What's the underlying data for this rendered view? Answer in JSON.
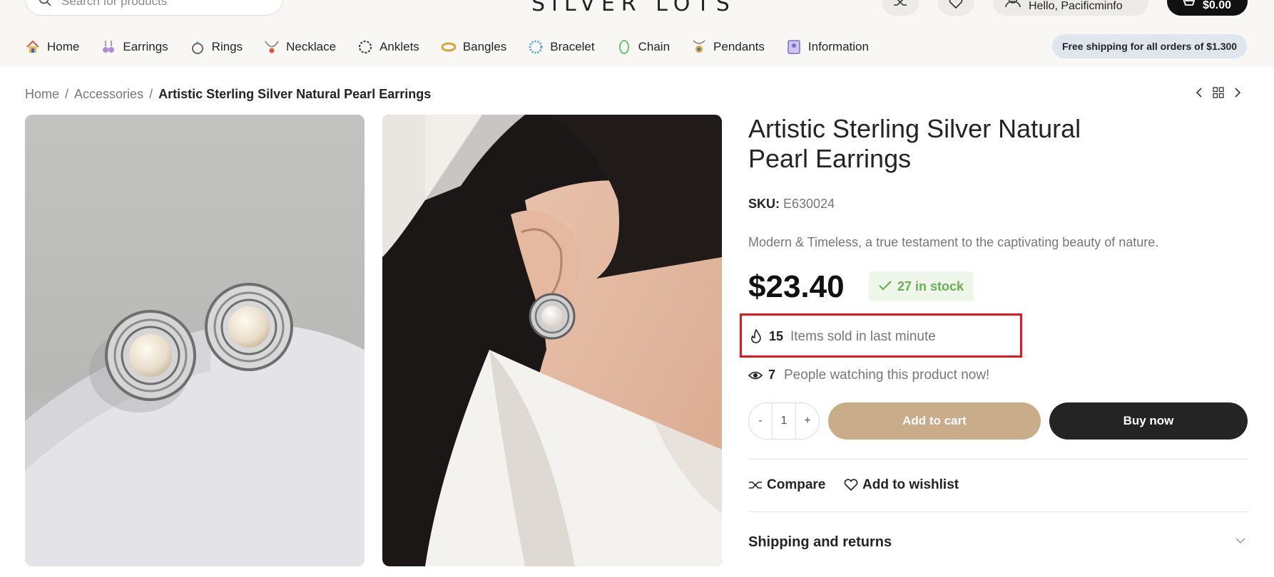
{
  "header": {
    "search_placeholder": "Search for products",
    "logo": "SILVER LOTS",
    "account_label": "Hello, Pacificminfo",
    "cart_total": "$0.00"
  },
  "nav": [
    {
      "label": "Home",
      "icon": "home-icon"
    },
    {
      "label": "Earrings",
      "icon": "earrings-icon"
    },
    {
      "label": "Rings",
      "icon": "ring-icon"
    },
    {
      "label": "Necklace",
      "icon": "necklace-icon"
    },
    {
      "label": "Anklets",
      "icon": "anklet-icon"
    },
    {
      "label": "Bangles",
      "icon": "bangle-icon"
    },
    {
      "label": "Bracelet",
      "icon": "bracelet-icon"
    },
    {
      "label": "Chain",
      "icon": "chain-icon"
    },
    {
      "label": "Pendants",
      "icon": "pendant-icon"
    },
    {
      "label": "Information",
      "icon": "info-icon"
    }
  ],
  "shipping_banner": "Free shipping for all orders of $1.300",
  "breadcrumb": {
    "home": "Home",
    "category": "Accessories",
    "current": "Artistic Sterling Silver Natural Pearl Earrings"
  },
  "product": {
    "title": "Artistic Sterling Silver Natural Pearl Earrings",
    "sku_label": "SKU:",
    "sku": "E630024",
    "description": "Modern & Timeless, a true testament to the captivating beauty of nature.",
    "price": "$23.40",
    "stock": "27 in stock",
    "sold_count": "15",
    "sold_label": "Items sold in last minute",
    "watch_count": "7",
    "watch_label": "People watching this product now!",
    "qty_minus": "-",
    "qty_value": "1",
    "qty_plus": "+",
    "add_to_cart": "Add to cart",
    "buy_now": "Buy now",
    "compare": "Compare",
    "wishlist": "Add to wishlist",
    "shipping_returns": "Shipping and returns"
  },
  "colors": {
    "accent": "#c9ad8b",
    "dark": "#242424",
    "stock_green": "#6aae56",
    "highlight_red": "#e8161c"
  }
}
